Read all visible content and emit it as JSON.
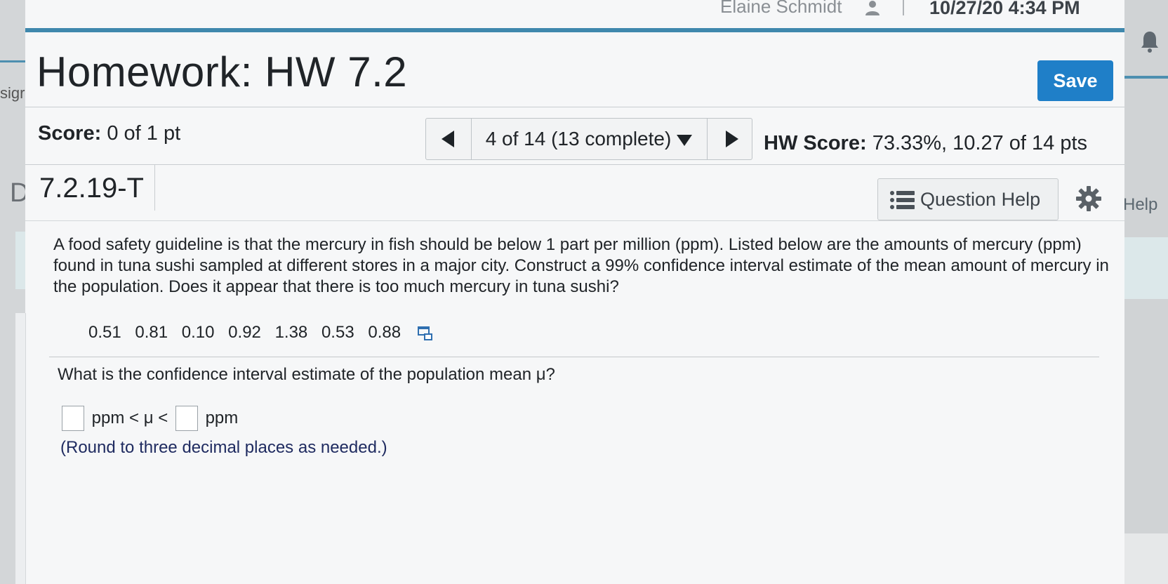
{
  "topbar": {
    "user_name": "Elaine Schmidt",
    "timestamp": "10/27/20 4:34 PM"
  },
  "fragments": {
    "left_sign": "sigr",
    "left_d": "D",
    "right_help": "Help"
  },
  "header": {
    "title": "Homework: HW 7.2",
    "save_label": "Save"
  },
  "score_bar": {
    "score_label": "Score:",
    "score_value": "0 of 1 pt",
    "nav_position": "4 of 14 (13 complete)",
    "hw_score_label": "HW Score:",
    "hw_score_value": "73.33%, 10.27 of 14 pts"
  },
  "question_bar": {
    "id": "7.2.19-T",
    "help_label": "Question Help"
  },
  "problem": {
    "text": "A food safety guideline is that the mercury in fish should be below 1 part per million (ppm). Listed below are the amounts of mercury (ppm) found in tuna sushi sampled at different stores in a major city. Construct a 99% confidence interval estimate of the mean amount of mercury in the population. Does it appear that there is too much mercury in tuna sushi?",
    "data_values": [
      "0.51",
      "0.81",
      "0.10",
      "0.92",
      "1.38",
      "0.53",
      "0.88"
    ],
    "question": "What is the confidence interval estimate of the population mean μ?",
    "answer_mid": "ppm < μ <",
    "answer_unit": "ppm",
    "hint": "(Round to three decimal places as needed.)"
  },
  "colors": {
    "accent_blue": "#3f88ad",
    "save_button": "#1f7fc8",
    "hint_text": "#1f2b60"
  }
}
